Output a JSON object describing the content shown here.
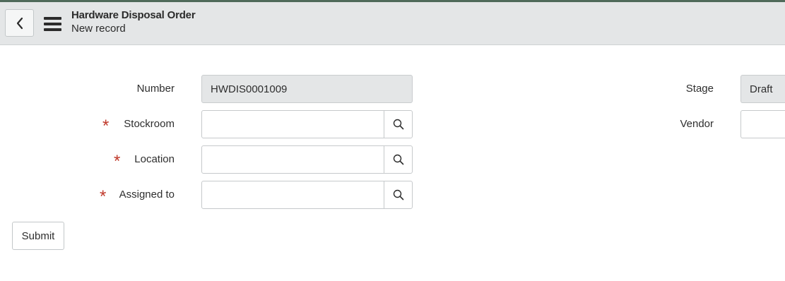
{
  "header": {
    "title": "Hardware Disposal Order",
    "subtitle": "New record"
  },
  "form": {
    "number": {
      "label": "Number",
      "value": "HWDIS0001009"
    },
    "stockroom": {
      "label": "Stockroom",
      "value": "",
      "required": true
    },
    "location": {
      "label": "Location",
      "value": "",
      "required": true
    },
    "assigned_to": {
      "label": "Assigned to",
      "value": "",
      "required": true
    },
    "stage": {
      "label": "Stage",
      "value": "Draft"
    },
    "vendor": {
      "label": "Vendor",
      "value": ""
    },
    "required_mark": "*"
  },
  "actions": {
    "submit_label": "Submit"
  },
  "icons": {
    "back": "chevron-left-icon",
    "menu": "hamburger-menu-icon",
    "search": "search-icon"
  },
  "colors": {
    "top_accent": "#4f6a5a",
    "header_bg": "#e4e6e7",
    "required": "#c0392b",
    "readonly_bg": "#e4e6e7"
  }
}
